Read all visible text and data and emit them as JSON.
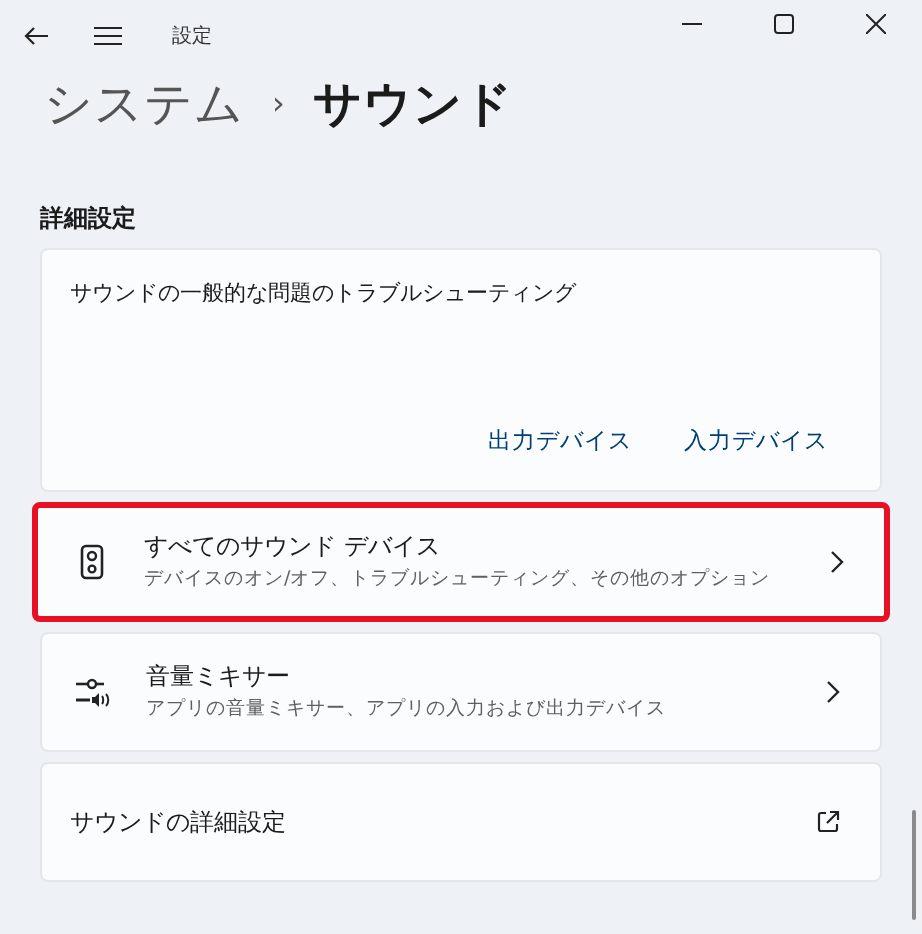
{
  "window": {
    "title": "設定"
  },
  "breadcrumb": {
    "parent": "システム",
    "separator": "›",
    "current": "サウンド"
  },
  "section": {
    "title": "詳細設定"
  },
  "troubleshoot": {
    "title": "サウンドの一般的な問題のトラブルシューティング",
    "links": [
      "出力デバイス",
      "入力デバイス"
    ]
  },
  "items": [
    {
      "kind": "speaker",
      "title": "すべてのサウンド デバイス",
      "subtitle": "デバイスのオン/オフ、トラブルシューティング、その他のオプション",
      "external": false,
      "highlighted": true
    },
    {
      "kind": "mixer",
      "title": "音量ミキサー",
      "subtitle": "アプリの音量ミキサー、アプリの入力および出力デバイス",
      "external": false,
      "highlighted": false
    },
    {
      "kind": "plain",
      "title": "サウンドの詳細設定",
      "external": true,
      "highlighted": false
    }
  ]
}
